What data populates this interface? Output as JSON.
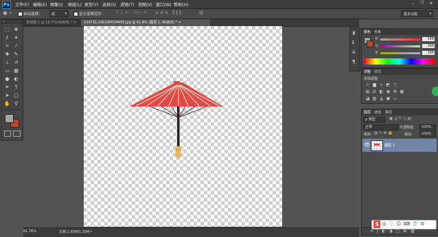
{
  "app": {
    "logo": "Ps"
  },
  "menu": [
    "文件(F)",
    "编辑(E)",
    "图像(I)",
    "图层(L)",
    "类型(Y)",
    "选择(S)",
    "滤镜(T)",
    "视图(V)",
    "窗口(W)",
    "帮助(H)"
  ],
  "options": {
    "auto_select_label": "自动选择：",
    "auto_select_value": "组",
    "show_transform_label": "显示变换控件",
    "workspace_value": "基本功能"
  },
  "tabs": [
    {
      "label": "未标题-1 @ 16.7%(RGB/8) *",
      "close": "×"
    },
    {
      "label": "234731-14010PH24450.jpg @ 61.8% (图层 1, RGB/8) *",
      "close": "×"
    }
  ],
  "status": {
    "zoom": "61.76%",
    "doc": "文档:2.85M/1.30M"
  },
  "color_panel": {
    "tabs": [
      "颜色",
      "色板"
    ],
    "r_label": "R",
    "g_label": "G",
    "b_label": "B",
    "r": "166",
    "g": "166",
    "b": "166"
  },
  "adjust_panel": {
    "tabs": [
      "调整",
      "样式"
    ],
    "title": "添加调整"
  },
  "layers_panel": {
    "tabs": [
      "图层",
      "通道",
      "路径"
    ],
    "kind": "ρ 类型",
    "blend": "正常",
    "opacity_label": "不透明度:",
    "opacity": "100%",
    "lock_label": "锁定:",
    "fill_label": "填充:",
    "fill": "100%",
    "layer_name": "图层 1"
  },
  "colors": {
    "foreground": "#a6a6a6",
    "background": "#b04a2f",
    "umbrella_red": "#e04a43",
    "handle_orange": "#e7b862",
    "accent_green": "#2fb45a"
  },
  "taskbar": {
    "ime": "S",
    "ime_text": "中"
  }
}
